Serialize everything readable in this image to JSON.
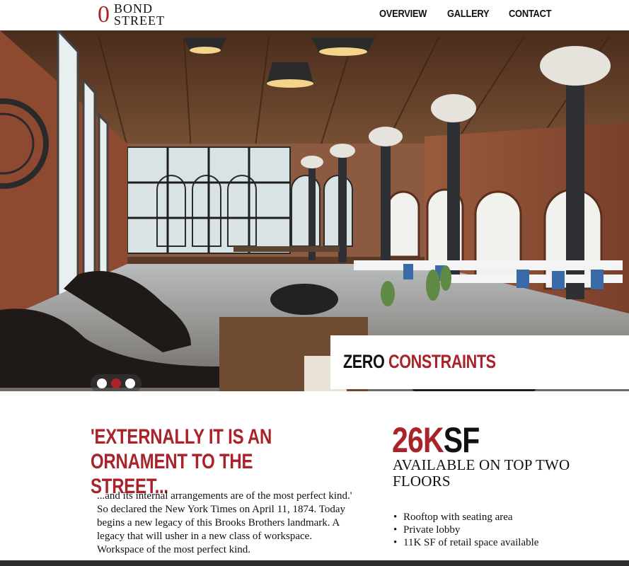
{
  "header": {
    "logo_mark": "0",
    "logo_line1": "BOND",
    "logo_line2": "STREET",
    "nav": [
      "OVERVIEW",
      "GALLERY",
      "CONTACT"
    ]
  },
  "hero": {
    "caption_part1": "ZERO",
    "caption_part2": "CONSTRAINTS",
    "slides_total": 3,
    "active_slide": 2
  },
  "quote": {
    "title": "'EXTERNALLY IT IS AN ORNAMENT TO THE STREET...",
    "body": "...and its internal arrangements are of the most perfect kind.' So declared the New York Times on April 11, 1874. Today begins a new legacy of this Brooks Brothers landmark. A legacy that will usher in a new class of workspace. Workspace of the most perfect kind."
  },
  "stats": {
    "number": "26K",
    "unit": "SF",
    "description": "AVAILABLE ON TOP TWO FLOORS",
    "features": [
      "Rooftop with seating area",
      "Private lobby",
      "11K SF of retail space available"
    ]
  },
  "colors": {
    "accent": "#a8232a",
    "text": "#111111",
    "footer": "#2c2c2c"
  }
}
